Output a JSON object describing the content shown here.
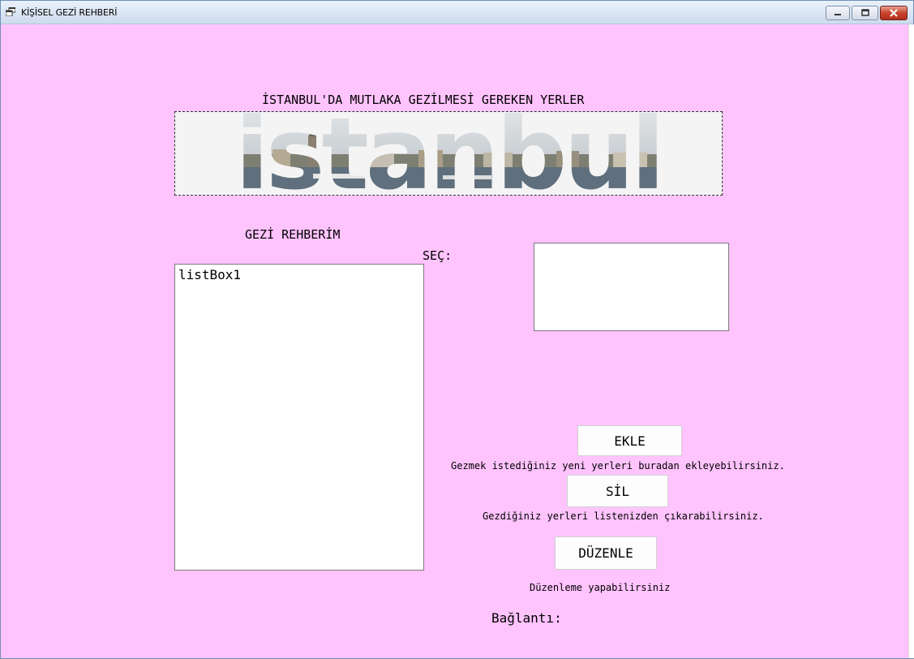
{
  "window": {
    "title": "KİŞİSEL GEZİ REHBERİ",
    "controls": [
      "minimize-icon",
      "maximize-icon",
      "close-icon"
    ]
  },
  "main": {
    "heading": "İSTANBUL'DA MUTLAKA GEZİLMESİ GEREKEN YERLER",
    "banner_text": "istanbul",
    "guide_label": "GEZİ REHBERİM",
    "listbox_item": "listBox1",
    "select_label": "SEÇ:",
    "add_button": "EKLE",
    "add_hint": "Gezmek istediğiniz yeni yerleri buradan ekleyebilirsiniz.",
    "delete_button": "SİL",
    "delete_hint": "Gezdiğiniz yerleri listenizden çıkarabilirsiniz.",
    "edit_button": "DÜZENLE",
    "edit_hint": "Düzenleme yapabilirsiniz",
    "link_label": "Bağlantı:"
  },
  "colors": {
    "form_background": "#ffc3fd",
    "titlebar": "#dce7f5",
    "close_button": "#c8432d"
  }
}
